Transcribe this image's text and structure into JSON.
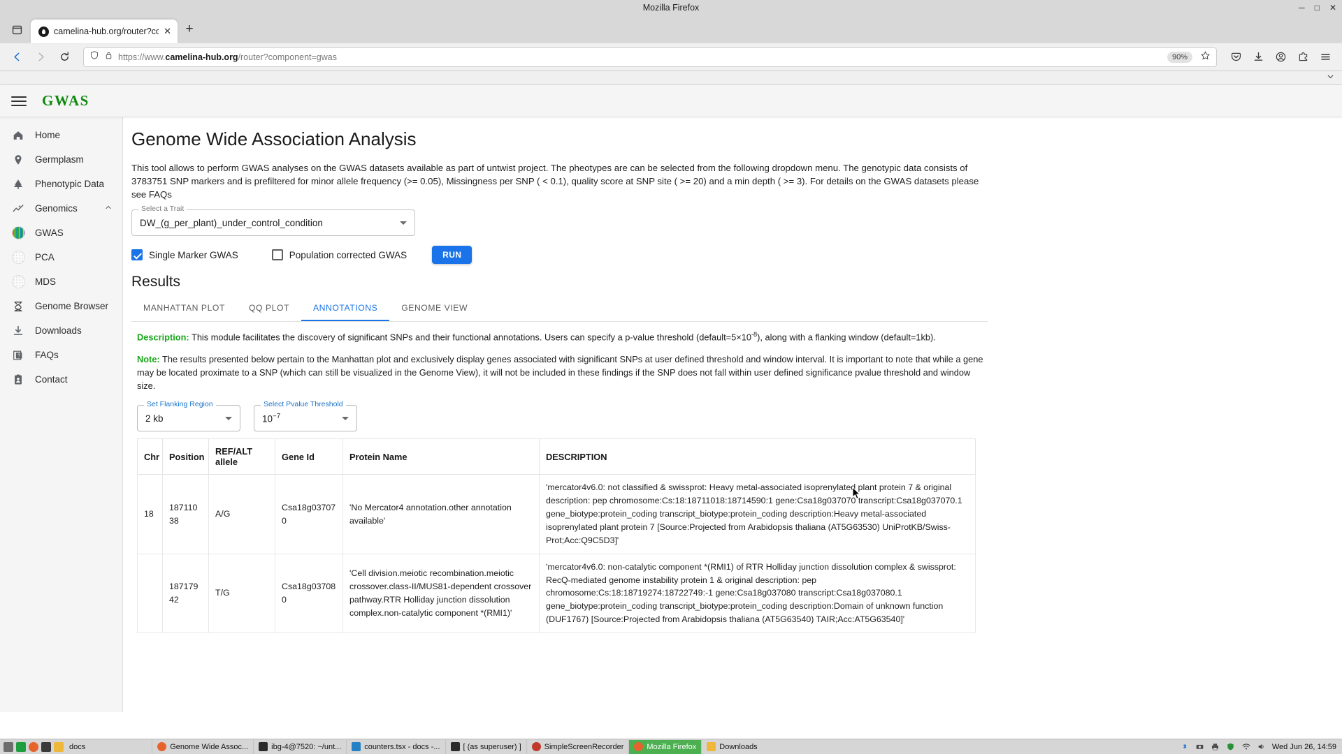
{
  "browser": {
    "window_title": "Mozilla Firefox",
    "window_controls": {
      "minimize": "─",
      "maximize": "□",
      "close": "✕"
    },
    "tab": {
      "title": "camelina-hub.org/router?co",
      "close": "✕",
      "favicon": "firefox-favicon"
    },
    "new_tab_label": "+",
    "url_prefix": "https://www.",
    "url_domain": "camelina-hub.org",
    "url_path": "/router?component=gwas",
    "zoom_level": "90%",
    "icons": {
      "back": "back-arrow-icon",
      "forward": "forward-arrow-icon",
      "reload": "reload-icon",
      "shield": "shield-icon",
      "lock": "lock-icon",
      "bookmark": "star-icon",
      "pocket": "pocket-icon",
      "download": "download-icon",
      "account": "account-icon",
      "extensions": "extensions-icon",
      "menu": "app-menu-icon",
      "list_all_tabs": "chevron-down-icon",
      "firefox_view": "firefox-view-icon"
    }
  },
  "app": {
    "brand": "GWAS",
    "menu_icon": "hamburger-menu-icon"
  },
  "sidebar": {
    "items": [
      {
        "label": "Home",
        "icon": "home-icon"
      },
      {
        "label": "Germplasm",
        "icon": "location-pin-icon"
      },
      {
        "label": "Phenotypic Data",
        "icon": "plant-leaf-icon"
      },
      {
        "label": "Genomics",
        "icon": "trending-chart-icon",
        "expanded": true,
        "caret": "chevron-up-icon"
      },
      {
        "label": "GWAS",
        "icon": "manhattan-plot-thumbnail",
        "sub": true
      },
      {
        "label": "PCA",
        "icon": "pca-scatter-thumbnail",
        "sub": true
      },
      {
        "label": "MDS",
        "icon": "mds-scatter-thumbnail",
        "sub": true
      },
      {
        "label": "Genome Browser",
        "icon": "dna-helix-icon"
      },
      {
        "label": "Downloads",
        "icon": "download-icon"
      },
      {
        "label": "FAQs",
        "icon": "faq-question-icon"
      },
      {
        "label": "Contact",
        "icon": "contact-card-icon"
      }
    ]
  },
  "main": {
    "page_title": "Genome Wide Association Analysis",
    "intro": "This tool allows to perform GWAS analyses on the GWAS datasets available as part of untwist project. The pheotypes are can be selected from the following dropdown menu. The genotypic data consists of 3783751 SNP markers and is prefiltered for minor allele frequency (>= 0.05), Missingness per SNP ( < 0.1), quality score at SNP site ( >= 20) and a min depth ( >= 3). For details on the GWAS datasets please see FAQs",
    "trait_select": {
      "legend": "Select a Trait",
      "value": "DW_(g_per_plant)_under_control_condition"
    },
    "checkbox_single": {
      "label": "Single Marker GWAS",
      "checked": true
    },
    "checkbox_popcorrected": {
      "label": "Population corrected GWAS",
      "checked": false
    },
    "run_button": "RUN",
    "results_title": "Results",
    "tabs": [
      {
        "label": "MANHATTAN PLOT",
        "active": false
      },
      {
        "label": "QQ PLOT",
        "active": false
      },
      {
        "label": "ANNOTATIONS",
        "active": true
      },
      {
        "label": "GENOME VIEW",
        "active": false
      }
    ],
    "description": {
      "key": "Description:",
      "text_before_sup": " This module facilitates the discovery of significant SNPs and their functional annotations. Users can specify a p-value threshold (default=5×10",
      "sup": "-8",
      "text_after_sup": "), along with a flanking window (default=1kb)."
    },
    "note": {
      "key": "Note:",
      "text": " The results presented below pertain to the Manhattan plot and exclusively display genes associated with significant SNPs at user defined threshold and window interval. It is important to note that while a gene may be located proximate to a SNP (which can still be visualized in the Genome View), it will not be included in these findings if the SNP does not fall within user defined significance pvalue threshold and window size."
    },
    "flank_select": {
      "legend": "Set Flanking Region",
      "value": "2 kb"
    },
    "pval_select": {
      "legend": "Select Pvalue Threshold",
      "value_base": "10",
      "value_exp": "−7"
    },
    "table": {
      "columns": [
        "Chr",
        "Position",
        "REF/ALT allele",
        "Gene Id",
        "Protein Name",
        "DESCRIPTION"
      ],
      "rows": [
        {
          "chr": "18",
          "position": "18711038",
          "ref_alt": "A/G",
          "gene_id": "Csa18g037070",
          "protein_name": "'No Mercator4 annotation.other annotation available'",
          "description": "'mercator4v6.0: not classified & swissprot: Heavy metal-associated isoprenylated plant protein 7 & original description: pep chromosome:Cs:18:18711018:18714590:1 gene:Csa18g037070 transcript:Csa18g037070.1 gene_biotype:protein_coding transcript_biotype:protein_coding description:Heavy metal-associated isoprenylated plant protein 7 [Source:Projected from Arabidopsis thaliana (AT5G63530) UniProtKB/Swiss-Prot;Acc:Q9C5D3]'"
        },
        {
          "chr": "",
          "position": "18717942",
          "ref_alt": "T/G",
          "gene_id": "Csa18g037080",
          "protein_name": "'Cell division.meiotic recombination.meiotic crossover.class-II/MUS81-dependent crossover pathway.RTR Holliday junction dissolution complex.non-catalytic component *(RMI1)'",
          "description": "'mercator4v6.0: non-catalytic component *(RMI1) of RTR Holliday junction dissolution complex & swissprot: RecQ-mediated genome instability protein 1 & original description: pep chromosome:Cs:18:18719274:18722749:-1 gene:Csa18g037080 transcript:Csa18g037080.1 gene_biotype:protein_coding transcript_biotype:protein_coding description:Domain of unknown function (DUF1767) [Source:Projected from Arabidopsis thaliana (AT5G63540) TAIR;Acc:AT5G63540]'"
        }
      ]
    }
  },
  "taskbar": {
    "launchers": [
      "file-manager-icon",
      "terminal-icon",
      "firefox-icon",
      "files-icon"
    ],
    "folder_label": "docs",
    "windows": [
      {
        "label": "Genome Wide Assoc...",
        "icon": "firefox-icon",
        "active": false
      },
      {
        "label": "ibg-4@7520: ~/unt...",
        "icon": "terminal-icon",
        "active": false
      },
      {
        "label": "counters.tsx - docs -...",
        "icon": "vscode-icon",
        "active": false
      },
      {
        "label": "[ (as superuser) ]",
        "icon": "terminal-icon",
        "active": false
      },
      {
        "label": "SimpleScreenRecorder",
        "icon": "recorder-icon",
        "active": false
      },
      {
        "label": "Mozilla Firefox",
        "icon": "firefox-icon",
        "active": true
      },
      {
        "label": "Downloads",
        "icon": "folder-icon",
        "active": false
      }
    ],
    "tray": [
      "bluetooth-icon",
      "camera-icon",
      "printer-icon",
      "shield-icon",
      "network-icon",
      "volume-icon"
    ],
    "clock": "Wed Jun 26, 14:59"
  }
}
